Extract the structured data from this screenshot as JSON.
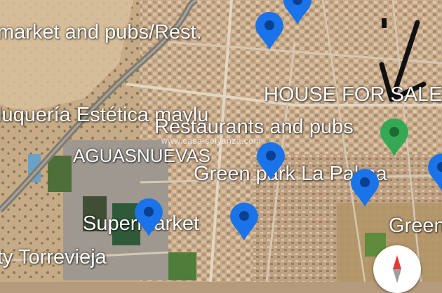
{
  "map": {
    "labels": {
      "supermarket_pubs": "market and pubs/Rest.",
      "house_for_sale": "HOUSE FOR SALE",
      "peluqueria": "luquería Estética maylu",
      "restaurants_pubs": "Restaurants and pubs",
      "aguasnuevas": "AGUASNUEVAS",
      "green_park": "Green park La Palma",
      "supermarket": "Supermarket",
      "green_edge": "Green",
      "torrevieja": "ty Torrevieja"
    },
    "watermark": "www.casa-solyanza.com",
    "colors": {
      "pin_blue": "#1a73e8",
      "pin_green": "#34a853",
      "compass_red": "#e53935"
    },
    "icons": {
      "pin": "location-pin-icon",
      "compass": "compass-icon",
      "arrow": "hand-drawn-arrow-icon"
    }
  }
}
